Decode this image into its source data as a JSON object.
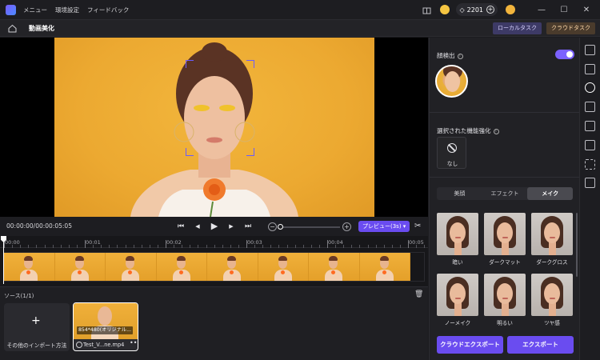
{
  "titlebar": {
    "menu": [
      "メニュー",
      "環境設定",
      "フィードバック"
    ],
    "credits": "2201",
    "window_controls": {
      "minimize": "—",
      "maximize": "☐",
      "close": "✕"
    }
  },
  "header": {
    "title": "動画美化",
    "local_task": "ローカルタスク",
    "cloud_task": "クラウドタスク"
  },
  "player": {
    "timecode": "00:00:00/00:00:05:05",
    "preview_label": "プレビュー(3s)",
    "controls": {
      "prev": "⏮",
      "step_back": "◀",
      "play": "▶",
      "step_fwd": "▶",
      "next": "⏭"
    }
  },
  "timeline": {
    "ticks": [
      "00:00",
      "00:01",
      "00:02",
      "00:03",
      "00:04",
      "00:05"
    ]
  },
  "source": {
    "title": "ソース(1/1)",
    "import_label": "その他のインポート方法",
    "media": {
      "resolution": "854*480(オリジナル...",
      "name": "Test_V...ne.mp4",
      "more": "•••"
    }
  },
  "panel": {
    "face_detect_title": "顔検出",
    "selected_features_title": "選択された機能強化",
    "none_label": "なし",
    "tabs": [
      {
        "label": "美顔",
        "active": false
      },
      {
        "label": "エフェクト",
        "active": false
      },
      {
        "label": "メイク",
        "active": true
      }
    ],
    "presets": [
      "暗い",
      "ダークマット",
      "ダークグロス",
      "ノーメイク",
      "明るい",
      "ツヤ感"
    ],
    "cloud_export": "クラウドエクスポート",
    "export": "エクスポート"
  },
  "colors": {
    "accent": "#6a4cf0",
    "background": "#1b1b1f",
    "photo_background": "#eca931"
  },
  "icons": [
    "app-logo-icon",
    "home-icon",
    "gift-icon",
    "coin-icon",
    "diamond-icon",
    "user-icon",
    "scissors-icon",
    "trash-icon"
  ]
}
